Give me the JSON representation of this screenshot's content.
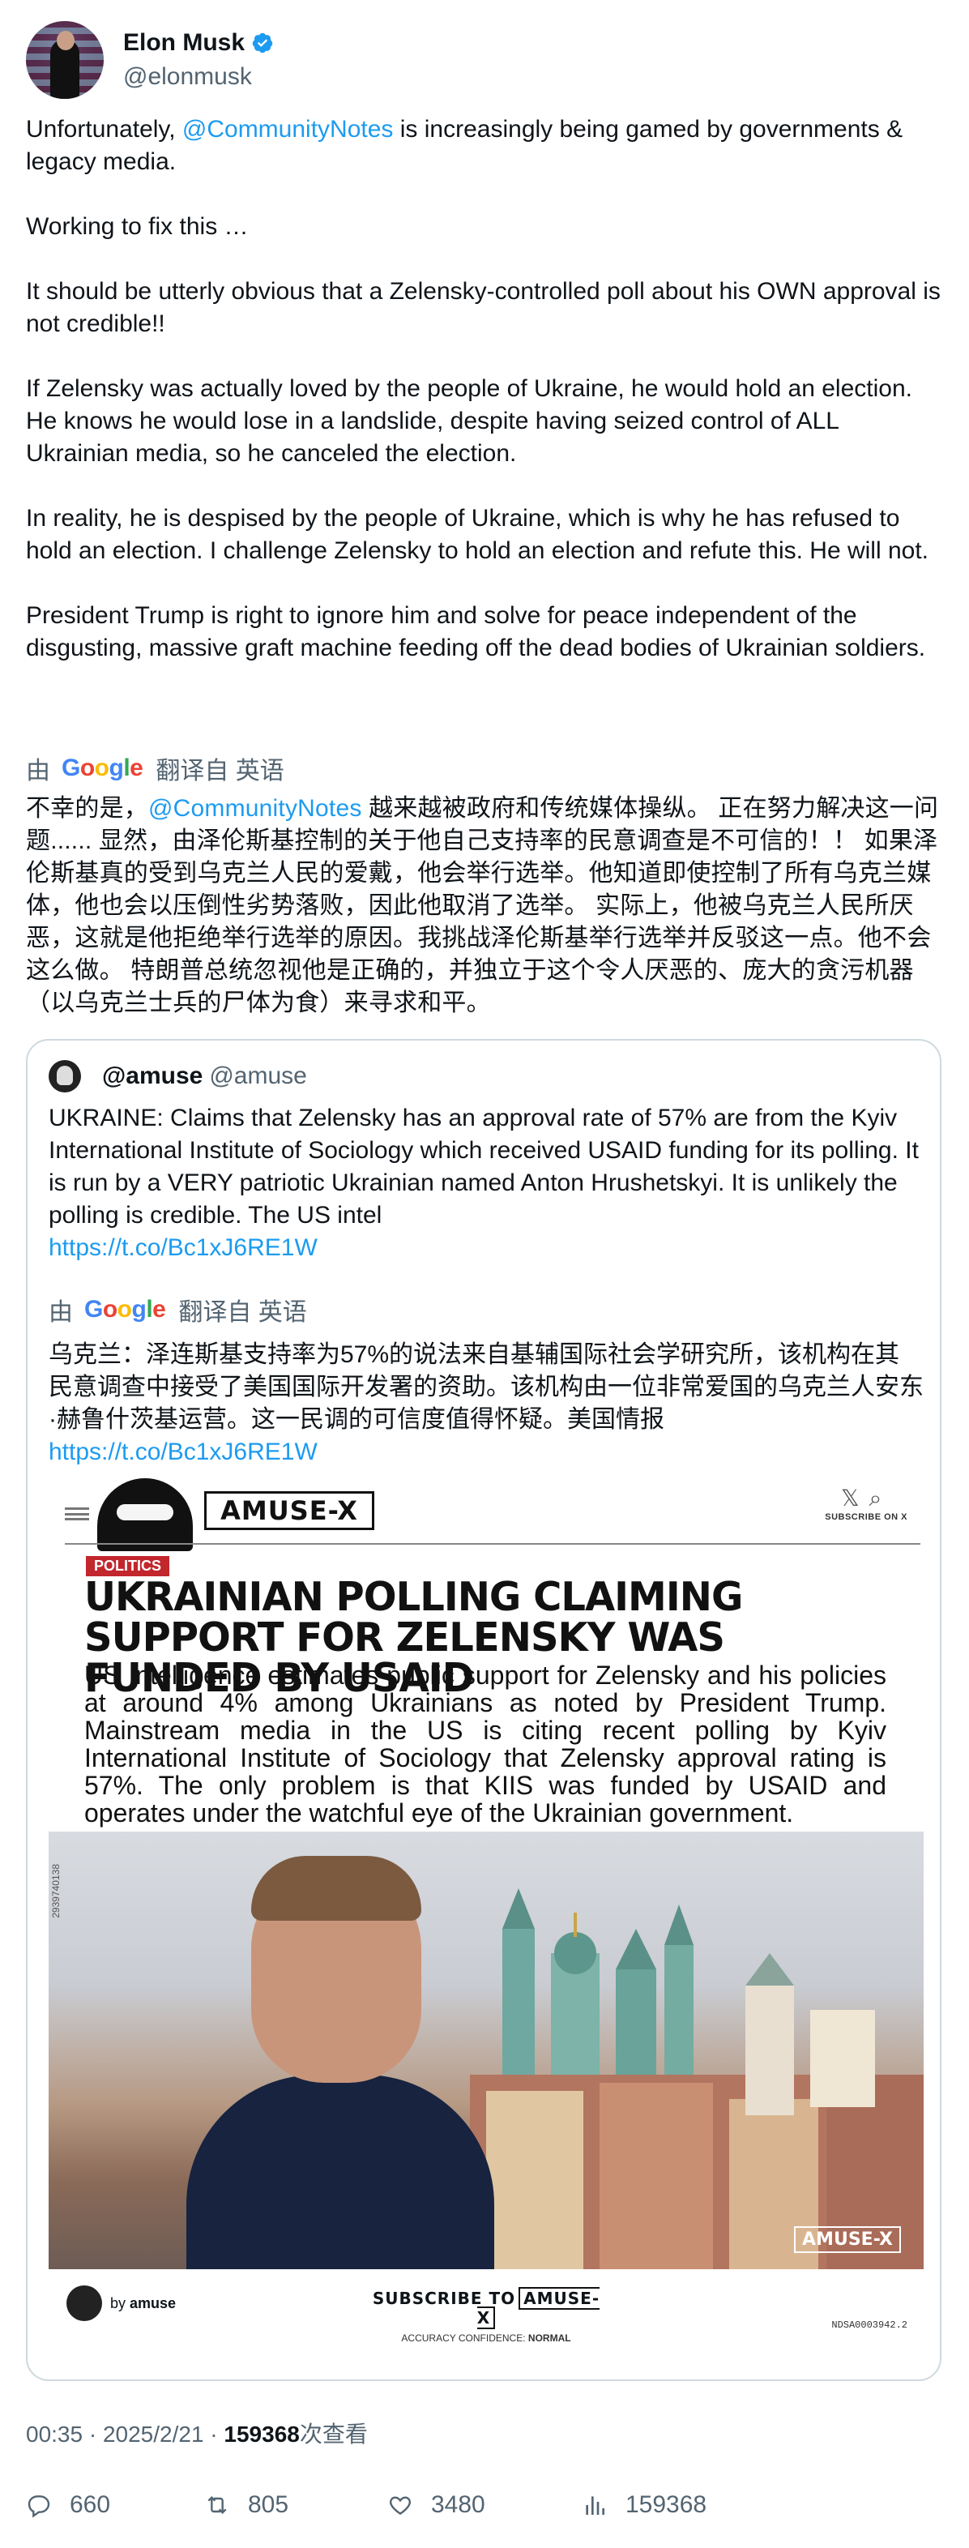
{
  "author": {
    "name": "Elon Musk",
    "handle": "@elonmusk"
  },
  "tweet": {
    "p1_pre": "Unfortunately, ",
    "p1_link": "@CommunityNotes",
    "p1_post": " is increasingly being gamed by governments & legacy media.",
    "p2": "Working to fix this …",
    "p3": "It should be utterly obvious that a Zelensky-controlled poll about his OWN approval is not credible!!",
    "p4": "If Zelensky was actually loved by the people of Ukraine, he would hold an election. He knows he would lose in a landslide, despite having seized control of ALL Ukrainian media, so he canceled the election.",
    "p5": "In reality, he is despised by the people of Ukraine, which is why he has refused to hold an election. I challenge Zelensky to hold an election and refute this. He will not.",
    "p6": "President Trump is right to ignore him and solve for peace independent of the disgusting, massive graft machine feeding off the dead bodies of Ukrainian soldiers."
  },
  "translation": {
    "by": "由",
    "google": "Google",
    "from": "翻译自 英语",
    "zh_pre": "不幸的是，",
    "zh_link": "@CommunityNotes",
    "zh_post": " 越来越被政府和传统媒体操纵。 正在努力解决这一问题...... 显然，由泽伦斯基控制的关于他自己支持率的民意调查是不可信的！！ 如果泽伦斯基真的受到乌克兰人民的爱戴，他会举行选举。他知道即使控制了所有乌克兰媒体，他也会以压倒性劣势落败，因此他取消了选举。 实际上，他被乌克兰人民所厌恶，这就是他拒绝举行选举的原因。我挑战泽伦斯基举行选举并反驳这一点。他不会这么做。 特朗普总统忽视他是正确的，并独立于这个令人厌恶的、庞大的贪污机器（以乌克兰士兵的尸体为食）来寻求和平。"
  },
  "quote": {
    "name": "@amuse",
    "handle": "@amuse",
    "text": "UKRAINE: Claims that Zelensky has an approval rate of 57% are from the Kyiv International Institute of Sociology which received USAID funding for its polling. It is run by a VERY patriotic Ukrainian named Anton Hrushetskyi. It is unlikely the polling is credible. The US intel",
    "link": "https://t.co/Bc1xJ6RE1W",
    "zh_text": "乌克兰：泽连斯基支持率为57%的说法来自基辅国际社会学研究所，该机构在其民意调查中接受了美国国际开发署的资助。该机构由一位非常爱国的乌克兰人安东·赫鲁什茨基运营。这一民调的可信度值得怀疑。美国情报",
    "zh_link": "https://t.co/Bc1xJ6RE1W"
  },
  "article": {
    "logo": "AMUSE-X",
    "subscribe_on": "SUBSCRIBE ON X",
    "category": "POLITICS",
    "headline": "UKRAINIAN POLLING CLAIMING SUPPORT FOR ZELENSKY WAS FUNDED BY USAID",
    "deck": "US Intelligence estimates public support for Zelensky and his policies at around 4% among Ukrainians as noted by President Trump. Mainstream media in the US is citing recent polling by Kyiv International Institute of Sociology that Zelensky approval rating is 57%. The only problem is that KIIS was funded by USAID and operates under the watchful eye of the Ukrainian government.",
    "photo_code": "2939740138",
    "watermark": "AMUSE-X",
    "by_label": "by",
    "by_name": "amuse",
    "subscribe_to": "SUBSCRIBE TO",
    "accuracy_label": "ACCURACY CONFIDENCE:",
    "accuracy_value": "NORMAL",
    "ndsa": "NDSA0003942.2"
  },
  "meta": {
    "time": "00:35 · 2025/2/21 · ",
    "views_num": "159368",
    "views_suffix": "次查看"
  },
  "stats": {
    "replies": "660",
    "reposts": "805",
    "likes": "3480",
    "views": "159368"
  },
  "colors": {
    "link": "#1d9bf0",
    "muted": "#536471",
    "border": "#cfd9de",
    "politics_tag": "#c1272d"
  }
}
